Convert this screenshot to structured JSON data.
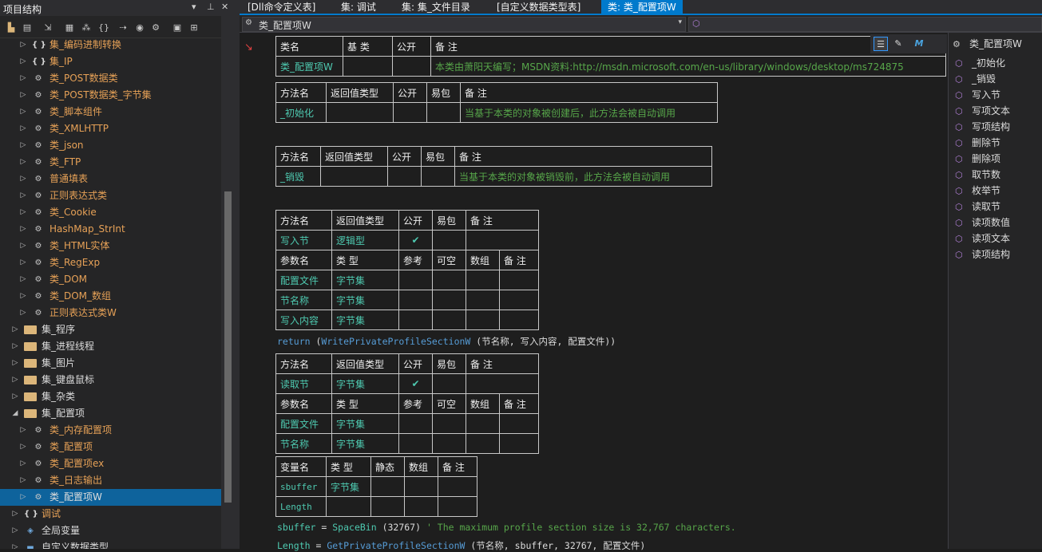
{
  "left_panel": {
    "title": "项目结构",
    "tree": [
      {
        "label": "集_编码进制转换",
        "icon": "brace-icon",
        "indent": 1,
        "color": "orange",
        "expanded": false
      },
      {
        "label": "集_IP",
        "icon": "brace-icon",
        "indent": 1,
        "color": "orange",
        "expanded": false
      },
      {
        "label": "类_POST数据类",
        "icon": "class-icon",
        "indent": 1,
        "color": "orange",
        "expanded": false
      },
      {
        "label": "类_POST数据类_字节集",
        "icon": "class-icon",
        "indent": 1,
        "color": "orange",
        "expanded": false
      },
      {
        "label": "类_脚本组件",
        "icon": "class-icon",
        "indent": 1,
        "color": "orange",
        "expanded": false
      },
      {
        "label": "类_XMLHTTP",
        "icon": "class-icon",
        "indent": 1,
        "color": "orange",
        "expanded": false
      },
      {
        "label": "类_json",
        "icon": "class-icon",
        "indent": 1,
        "color": "orange",
        "expanded": false
      },
      {
        "label": "类_FTP",
        "icon": "class-icon",
        "indent": 1,
        "color": "orange",
        "expanded": false
      },
      {
        "label": "普通填表",
        "icon": "class-icon",
        "indent": 1,
        "color": "orange",
        "expanded": false
      },
      {
        "label": "正则表达式类",
        "icon": "class-icon",
        "indent": 1,
        "color": "orange",
        "expanded": false
      },
      {
        "label": "类_Cookie",
        "icon": "class-icon",
        "indent": 1,
        "color": "orange",
        "expanded": false
      },
      {
        "label": "HashMap_StrInt",
        "icon": "class-icon",
        "indent": 1,
        "color": "orange",
        "expanded": false
      },
      {
        "label": "类_HTML实体",
        "icon": "class-icon",
        "indent": 1,
        "color": "orange",
        "expanded": false
      },
      {
        "label": "类_RegExp",
        "icon": "class-icon",
        "indent": 1,
        "color": "orange",
        "expanded": false
      },
      {
        "label": "类_DOM",
        "icon": "class-icon",
        "indent": 1,
        "color": "orange",
        "expanded": false
      },
      {
        "label": "类_DOM_数组",
        "icon": "class-icon",
        "indent": 1,
        "color": "orange",
        "expanded": false
      },
      {
        "label": "正则表达式类W",
        "icon": "class-icon",
        "indent": 1,
        "color": "orange",
        "expanded": false
      },
      {
        "label": "集_程序",
        "icon": "folder-icon",
        "indent": 0,
        "color": "white",
        "expanded": false
      },
      {
        "label": "集_进程线程",
        "icon": "folder-icon",
        "indent": 0,
        "color": "white",
        "expanded": false
      },
      {
        "label": "集_图片",
        "icon": "folder-icon",
        "indent": 0,
        "color": "white",
        "expanded": false
      },
      {
        "label": "集_键盘鼠标",
        "icon": "folder-icon",
        "indent": 0,
        "color": "white",
        "expanded": false
      },
      {
        "label": "集_杂类",
        "icon": "folder-icon",
        "indent": 0,
        "color": "white",
        "expanded": false
      },
      {
        "label": "集_配置项",
        "icon": "folder-icon",
        "indent": 0,
        "color": "white",
        "expanded": true
      },
      {
        "label": "类_内存配置项",
        "icon": "class-icon",
        "indent": 1,
        "color": "orange",
        "expanded": false
      },
      {
        "label": "类_配置项",
        "icon": "class-icon",
        "indent": 1,
        "color": "orange",
        "expanded": false
      },
      {
        "label": "类_配置项ex",
        "icon": "class-icon",
        "indent": 1,
        "color": "orange",
        "expanded": false
      },
      {
        "label": "类_日志输出",
        "icon": "class-icon",
        "indent": 1,
        "color": "orange",
        "expanded": false
      },
      {
        "label": "类_配置项W",
        "icon": "class-icon",
        "indent": 1,
        "color": "white",
        "expanded": false,
        "selected": true
      },
      {
        "label": "调试",
        "icon": "brace-icon",
        "indent": 0,
        "color": "orange",
        "expanded": false
      },
      {
        "label": "全局变量",
        "icon": "globe-icon",
        "indent": 0,
        "color": "white",
        "expanded": false
      },
      {
        "label": "自定义数据类型",
        "icon": "struct-icon",
        "indent": 0,
        "color": "white",
        "expanded": false
      }
    ]
  },
  "tabs": [
    {
      "label": "[Dll命令定义表]",
      "active": false
    },
    {
      "label": "集: 调试",
      "active": false
    },
    {
      "label": "集: 集_文件目录",
      "active": false
    },
    {
      "label": "[自定义数据类型表]",
      "active": false
    },
    {
      "label": "类: 类_配置项W",
      "active": true
    }
  ],
  "nav": {
    "class_combo": "类_配置项W"
  },
  "editor": {
    "class_table": {
      "headers": [
        "类名",
        "基 类",
        "公开",
        "备 注"
      ],
      "row": [
        "类_配置项W",
        "",
        "",
        "本类由萧阳天编写；MSDN资料:http://msdn.microsoft.com/en-us/library/windows/desktop/ms724875"
      ]
    },
    "method_init": {
      "headers": [
        "方法名",
        "返回值类型",
        "公开",
        "易包",
        "备 注"
      ],
      "row": [
        "_初始化",
        "",
        "",
        "",
        "当基于本类的对象被创建后，此方法会被自动调用"
      ]
    },
    "method_destroy": {
      "headers": [
        "方法名",
        "返回值类型",
        "公开",
        "易包",
        "备 注"
      ],
      "row": [
        "_销毁",
        "",
        "",
        "",
        "当基于本类的对象被销毁前，此方法会被自动调用"
      ]
    },
    "method_write": {
      "headers": [
        "方法名",
        "返回值类型",
        "公开",
        "易包",
        "备 注"
      ],
      "row": [
        "写入节",
        "逻辑型",
        "✔",
        "",
        ""
      ],
      "param_headers": [
        "参数名",
        "类 型",
        "参考",
        "可空",
        "数组",
        "备 注"
      ],
      "params": [
        [
          "配置文件",
          "字节集",
          "",
          "",
          "",
          ""
        ],
        [
          "节名称",
          "字节集",
          "",
          "",
          "",
          ""
        ],
        [
          "写入内容",
          "字节集",
          "",
          "",
          "",
          ""
        ]
      ]
    },
    "code_return": {
      "keyword": "return",
      "text": " (",
      "fn": "WritePrivateProfileSectionW",
      "args": " (节名称, 写入内容, 配置文件))"
    },
    "method_read": {
      "headers": [
        "方法名",
        "返回值类型",
        "公开",
        "易包",
        "备 注"
      ],
      "row": [
        "读取节",
        "字节集",
        "✔",
        "",
        ""
      ],
      "param_headers": [
        "参数名",
        "类 型",
        "参考",
        "可空",
        "数组",
        "备 注"
      ],
      "params": [
        [
          "配置文件",
          "字节集",
          "",
          "",
          "",
          ""
        ],
        [
          "节名称",
          "字节集",
          "",
          "",
          "",
          ""
        ]
      ]
    },
    "var_table": {
      "headers": [
        "变量名",
        "类 型",
        "静态",
        "数组",
        "备 注"
      ],
      "rows": [
        [
          "sbuffer",
          "字节集",
          "",
          "",
          ""
        ],
        [
          "Length",
          "",
          "",
          "",
          ""
        ]
      ]
    },
    "code_line1": {
      "var": "sbuffer",
      "op": " = ",
      "fn": "SpaceBin",
      "args": " (32767)",
      "comment": "  ' The maximum profile section size is 32,767 characters."
    },
    "code_line2": {
      "var": "Length",
      "op": " = ",
      "fn": "GetPrivateProfileSectionW",
      "args": " (节名称, sbuffer, 32767, 配置文件)"
    }
  },
  "right_panel": {
    "header": "类_配置项W",
    "items": [
      "_初始化",
      "_销毁",
      "写入节",
      "写项文本",
      "写项结构",
      "删除节",
      "删除项",
      "取节数",
      "枚举节",
      "读取节",
      "读项数值",
      "读项文本",
      "读项结构"
    ]
  }
}
